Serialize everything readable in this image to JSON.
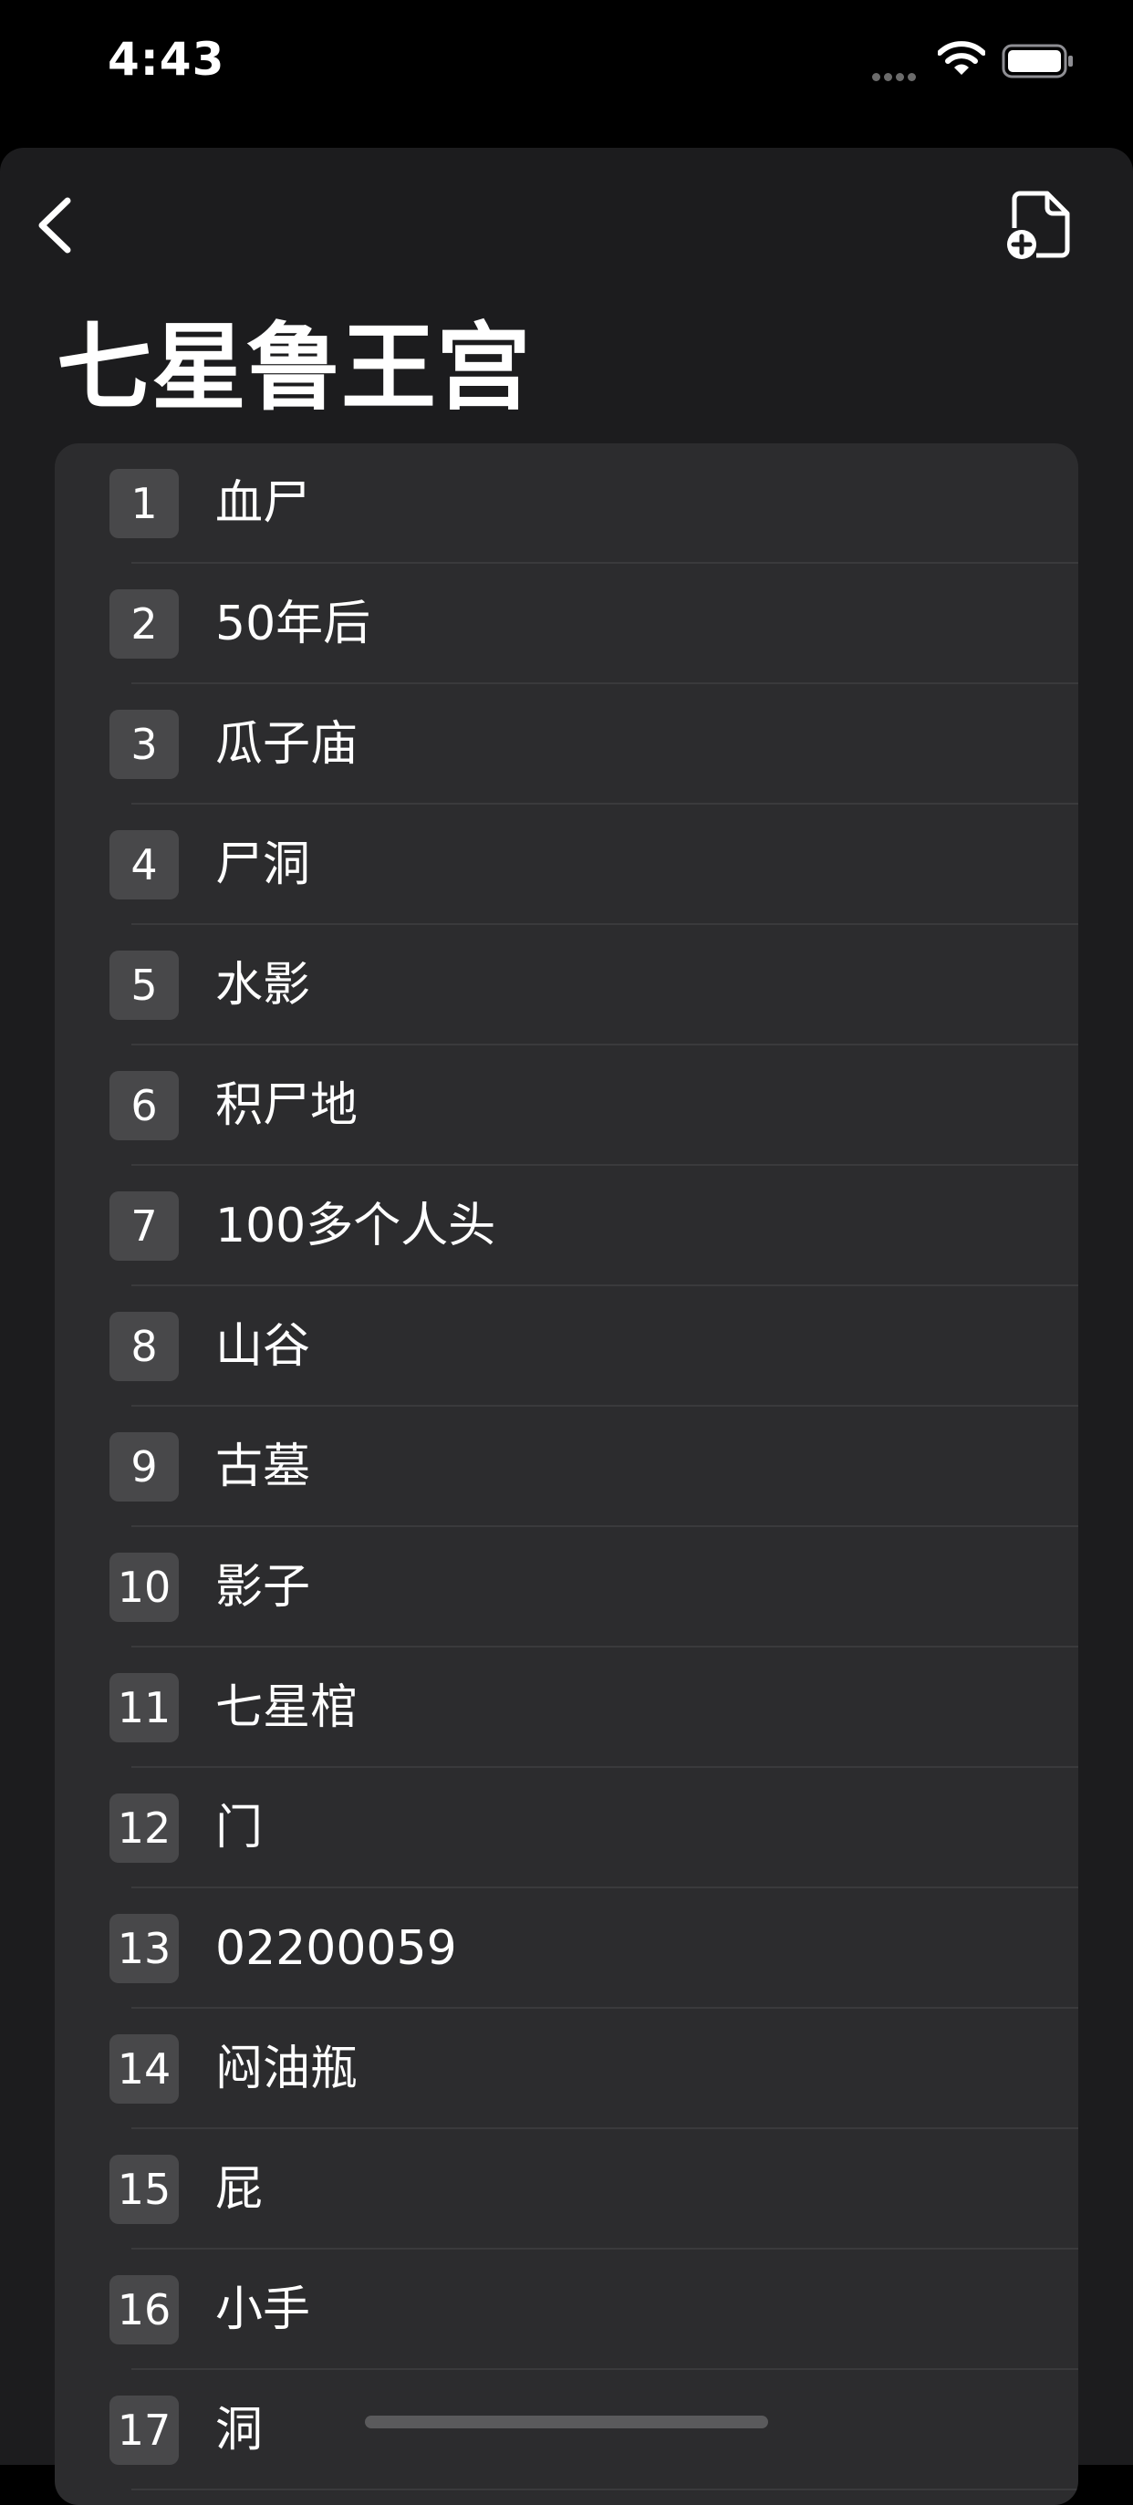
{
  "status_bar": {
    "time": "4:43"
  },
  "header": {
    "title": "七星鲁王宫"
  },
  "icons": {
    "back": "chevron-left-icon",
    "new_file": "document-plus-icon",
    "wifi": "wifi-icon",
    "battery": "battery-icon"
  },
  "list": {
    "items": [
      {
        "number": "1",
        "title": "血尸"
      },
      {
        "number": "2",
        "title": "50年后"
      },
      {
        "number": "3",
        "title": "瓜子庙"
      },
      {
        "number": "4",
        "title": "尸洞"
      },
      {
        "number": "5",
        "title": "水影"
      },
      {
        "number": "6",
        "title": "积尸地"
      },
      {
        "number": "7",
        "title": "100多个人头"
      },
      {
        "number": "8",
        "title": "山谷"
      },
      {
        "number": "9",
        "title": "古墓"
      },
      {
        "number": "10",
        "title": "影子"
      },
      {
        "number": "11",
        "title": "七星棺"
      },
      {
        "number": "12",
        "title": "门"
      },
      {
        "number": "13",
        "title": "02200059"
      },
      {
        "number": "14",
        "title": "闷油瓶"
      },
      {
        "number": "15",
        "title": "屁"
      },
      {
        "number": "16",
        "title": "小手"
      },
      {
        "number": "17",
        "title": "洞"
      }
    ]
  },
  "colors": {
    "background": "#000000",
    "sheet": "#1c1c1e",
    "card": "#2c2c2e",
    "badge": "#48484a",
    "separator": "#3a3a3c"
  }
}
